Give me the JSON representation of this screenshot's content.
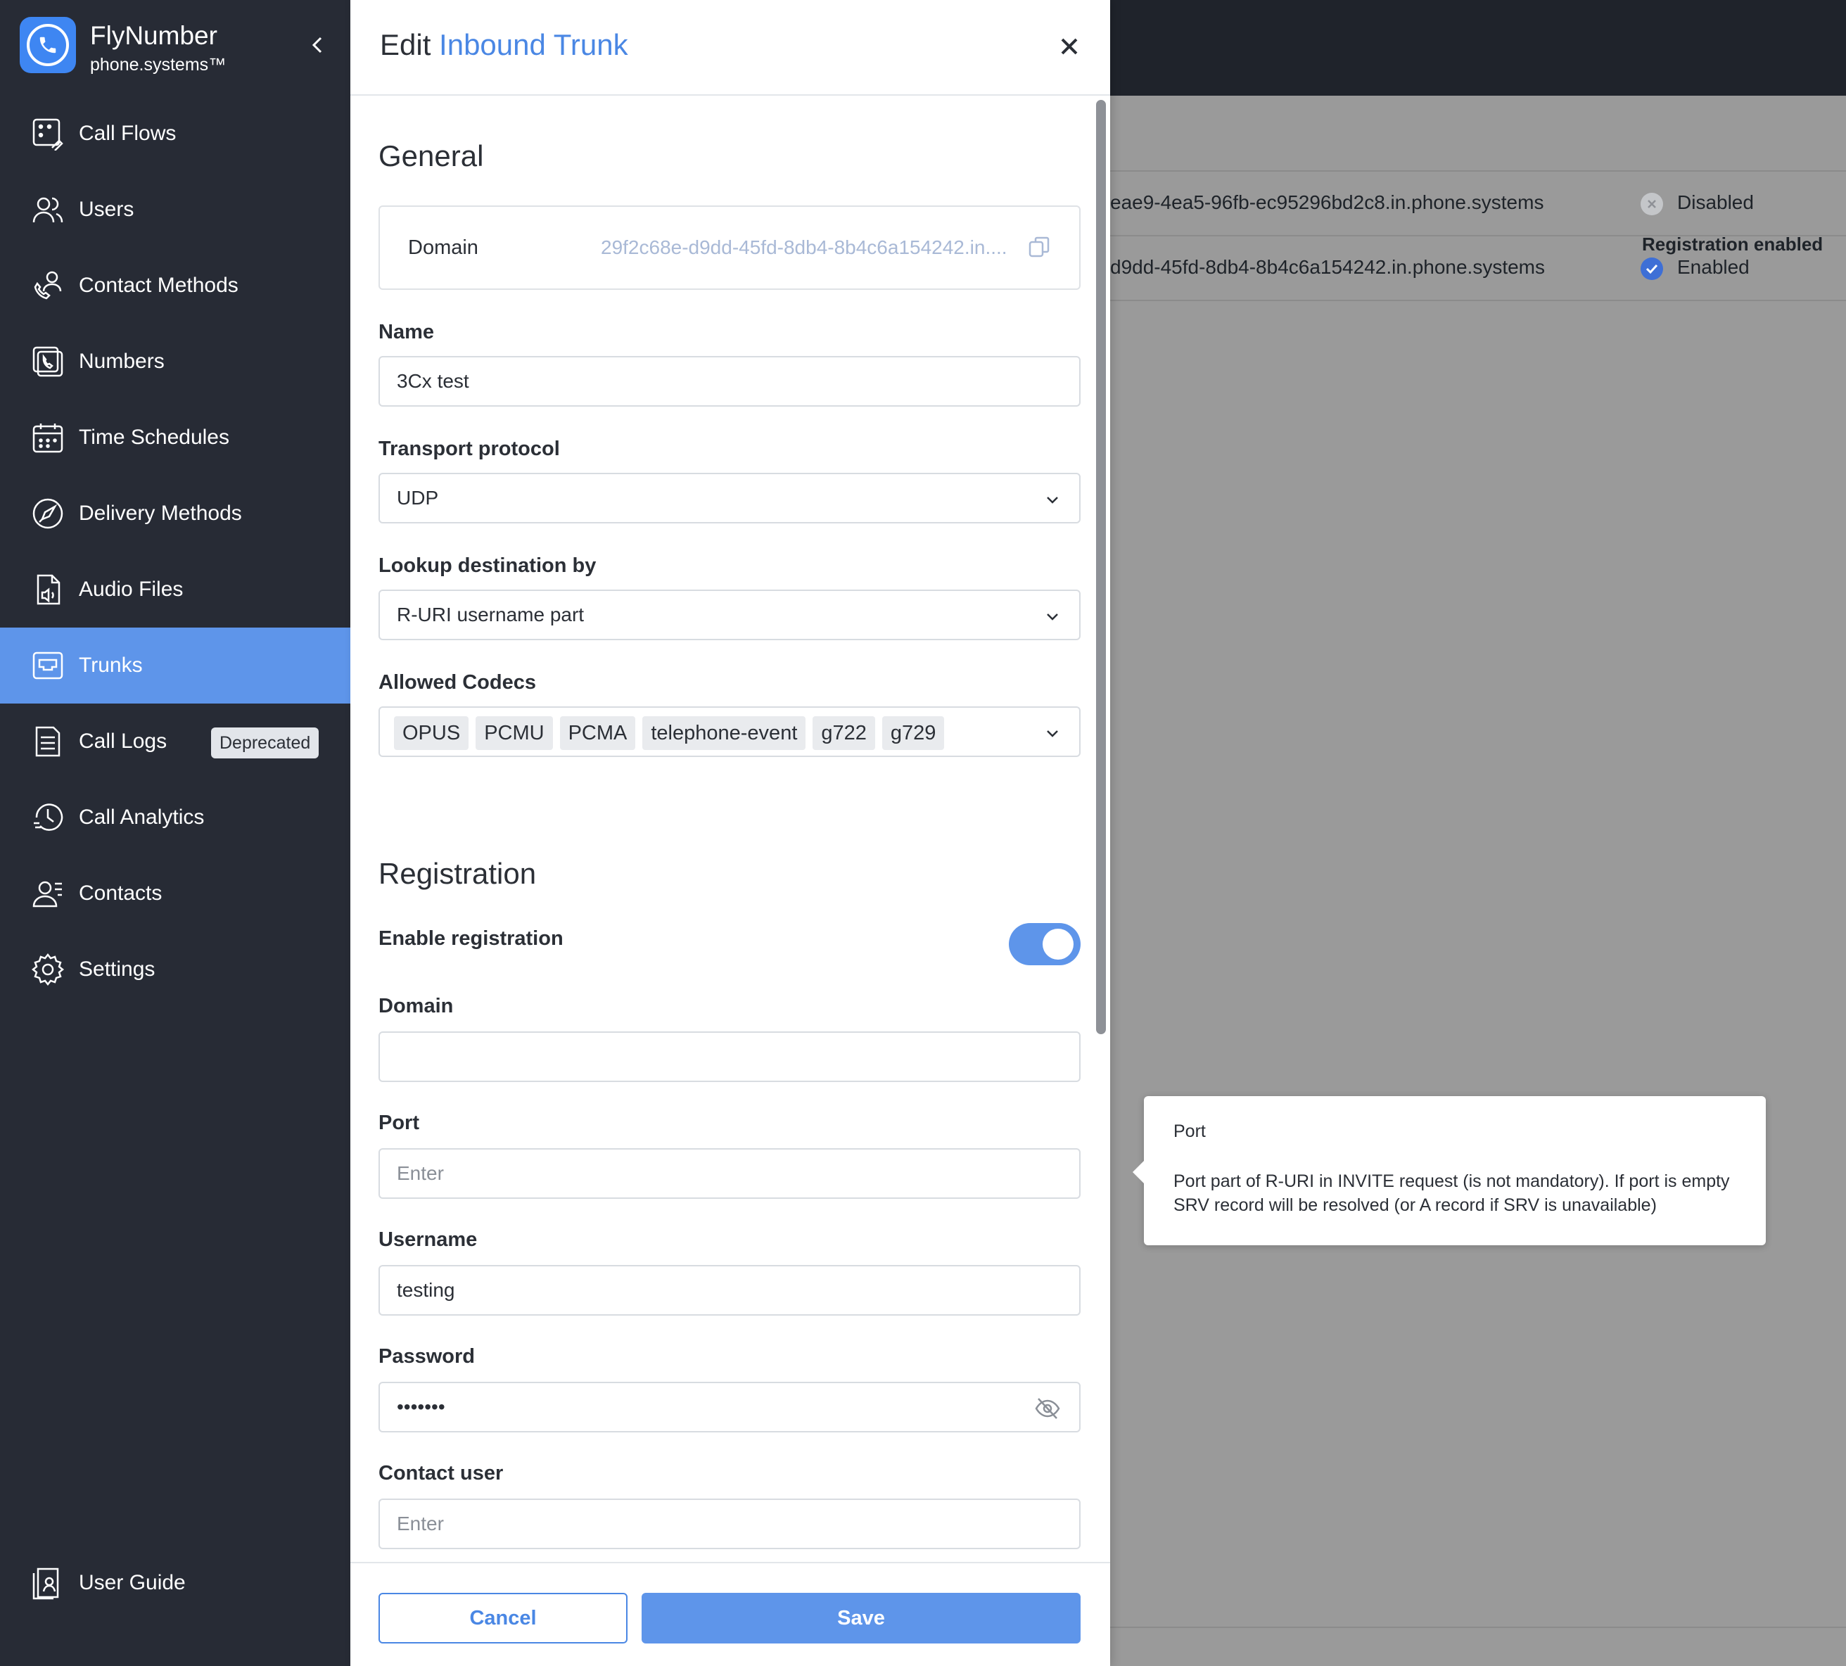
{
  "brand": {
    "name": "FlyNumber",
    "sub": "phone.systems™"
  },
  "sidebar": {
    "items": [
      {
        "label": "Call Flows",
        "icon": "call-flows-icon"
      },
      {
        "label": "Users",
        "icon": "users-icon"
      },
      {
        "label": "Contact Methods",
        "icon": "contact-methods-icon"
      },
      {
        "label": "Numbers",
        "icon": "numbers-icon"
      },
      {
        "label": "Time Schedules",
        "icon": "calendar-icon"
      },
      {
        "label": "Delivery Methods",
        "icon": "rocket-icon"
      },
      {
        "label": "Audio Files",
        "icon": "audio-file-icon"
      },
      {
        "label": "Trunks",
        "icon": "trunk-icon"
      },
      {
        "label": "Call Logs",
        "icon": "document-icon",
        "badge": "Deprecated"
      },
      {
        "label": "Call Analytics",
        "icon": "analytics-clock-icon"
      },
      {
        "label": "Contacts",
        "icon": "contacts-icon"
      },
      {
        "label": "Settings",
        "icon": "gear-icon"
      }
    ],
    "active_index": 7,
    "guide": "User Guide"
  },
  "background": {
    "header_registration": "Registration enabled",
    "rows": [
      {
        "domain": "eae9-4ea5-96fb-ec95296bd2c8.in.phone.systems",
        "status": "Disabled"
      },
      {
        "domain": "d9dd-45fd-8db4-8b4c6a154242.in.phone.systems",
        "status": "Enabled"
      }
    ]
  },
  "drawer": {
    "title_prefix": "Edit",
    "title_accent": "Inbound Trunk",
    "general": {
      "title": "General",
      "domain_label": "Domain",
      "domain_value": "29f2c68e-d9dd-45fd-8db4-8b4c6a154242.in....",
      "name_label": "Name",
      "name_value": "3Cx test",
      "transport_label": "Transport protocol",
      "transport_value": "UDP",
      "lookup_label": "Lookup destination by",
      "lookup_value": "R-URI username part",
      "codecs_label": "Allowed Codecs",
      "codecs": [
        "OPUS",
        "PCMU",
        "PCMA",
        "telephone-event",
        "g722",
        "g729"
      ]
    },
    "registration": {
      "title": "Registration",
      "enable_label": "Enable registration",
      "enabled": true,
      "domain_label": "Domain",
      "domain_value": "",
      "port_label": "Port",
      "port_placeholder": "Enter",
      "username_label": "Username",
      "username_value": "testing",
      "password_label": "Password",
      "password_value": "•••••••",
      "contact_label": "Contact user",
      "contact_placeholder": "Enter"
    },
    "footer": {
      "cancel": "Cancel",
      "save": "Save"
    }
  },
  "tooltip": {
    "title": "Port",
    "text": "Port part of R-URI in INVITE request (is not mandatory). If port is empty SRV record will be resolved (or A record if SRV is unavailable)"
  },
  "colors": {
    "accent": "#5e95ea",
    "sidebar": "#272b35",
    "title_accent": "#4a87e4"
  }
}
